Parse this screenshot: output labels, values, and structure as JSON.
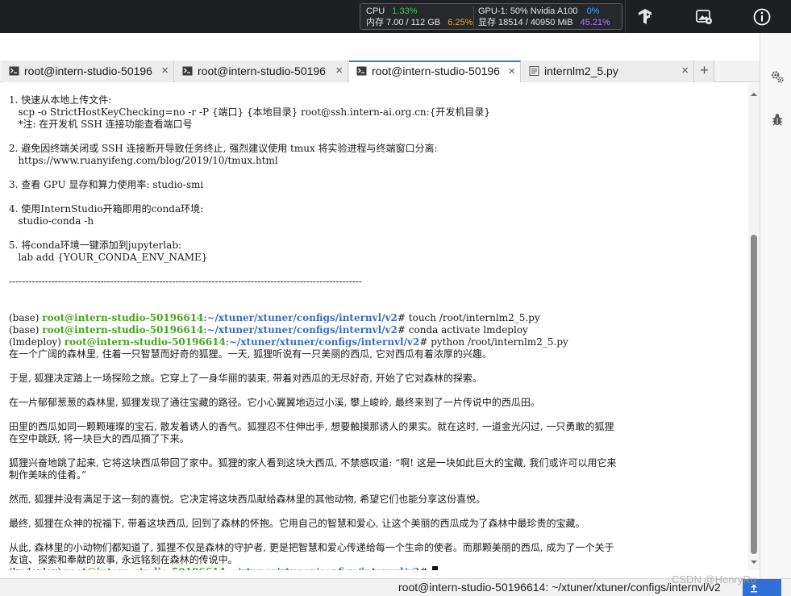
{
  "monitor": {
    "cpu_label": "CPU",
    "cpu_pct": "1.33%",
    "mem_text": "内存 7.00 / 112 GB",
    "mem_pct": "6.25%",
    "gpu_label": "GPU-1: 50% Nvidia A100",
    "gpu_pct": "0%",
    "vram_text": "显存 18514 / 40950 MiB",
    "vram_pct": "45.21%"
  },
  "topbar_icons": [
    "tensorflow-icon",
    "image-settings-icon",
    "info-icon"
  ],
  "tabs": [
    {
      "label": "root@intern-studio-50196",
      "icon": "terminal-icon",
      "active": false
    },
    {
      "label": "root@intern-studio-50196",
      "icon": "terminal-icon",
      "active": false
    },
    {
      "label": "root@intern-studio-50196",
      "icon": "terminal-icon",
      "active": true
    },
    {
      "label": "internlm2_5.py",
      "icon": "file-icon",
      "active": false
    }
  ],
  "tab_close_symbol": "×",
  "tab_add_symbol": "+",
  "terminal": {
    "lines": [
      "1. 快速从本地上传文件:",
      "   scp -o StrictHostKeyChecking=no -r -P {端口} {本地目录} root@ssh.intern-ai.org.cn:{开发机目录}",
      "   *注: 在开发机 SSH 连接功能查看端口号",
      "",
      "2. 避免因终端关闭或 SSH 连接断开导致任务终止, 强烈建议使用 tmux 将实验进程与终端窗口分离:",
      "   https://www.ruanyifeng.com/blog/2019/10/tmux.html",
      "",
      "3. 查看 GPU 显存和算力使用率: studio-smi",
      "",
      "4. 使用InternStudio开箱即用的conda环境:",
      "   studio-conda -h",
      "",
      "5. 将conda环境一键添加到jupyterlab:",
      "   lab add {YOUR_CONDA_ENV_NAME}",
      "",
      "------------------------------------------------------------------------------------------------------------"
    ],
    "prompts": [
      {
        "env": "(base) ",
        "user": "root@intern-studio-50196614",
        "path": "~/xtuner/xtuner/configs/internvl/v2",
        "cmd": "# touch /root/internlm2_5.py"
      },
      {
        "env": "(base) ",
        "user": "root@intern-studio-50196614",
        "path": "~/xtuner/xtuner/configs/internvl/v2",
        "cmd": "# conda activate lmdeploy"
      },
      {
        "env": "(lmdeploy) ",
        "user": "root@intern-studio-50196614",
        "path": "~/xtuner/xtuner/configs/internvl/v2",
        "cmd": "# python /root/internlm2_5.py"
      }
    ],
    "story": [
      "在一个广阔的森林里, 住着一只智慧而好奇的狐狸。一天, 狐狸听说有一只美丽的西瓜, 它对西瓜有着浓厚的兴趣。",
      "",
      "于是, 狐狸决定踏上一场探险之旅。它穿上了一身华丽的装束, 带着对西瓜的无尽好奇, 开始了它对森林的探索。",
      "",
      "在一片郁郁葱葱的森林里, 狐狸发现了通往宝藏的路径。它小心翼翼地迈过小溪, 攀上峻岭, 最终来到了一片传说中的西瓜田。",
      "",
      "田里的西瓜如同一颗颗璀璨的宝石, 散发着诱人的香气。狐狸忍不住伸出手, 想要触摸那诱人的果实。就在这时, 一道金光闪过, 一只勇敢的狐狸",
      "在空中跳跃, 将一块巨大的西瓜摘了下来。",
      "",
      "狐狸兴奋地跳了起来, 它将这块西瓜带回了家中。狐狸的家人看到这块大西瓜, 不禁感叹道: “啊! 这是一块如此巨大的宝藏, 我们或许可以用它来",
      "制作美味的佳肴。”",
      "",
      "然而, 狐狸并没有满足于这一刻的喜悦。它决定将这块西瓜献给森林里的其他动物, 希望它们也能分享这份喜悦。",
      "",
      "最终, 狐狸在众神的祝福下, 带着这块西瓜, 回到了森林的怀抱。它用自己的智慧和爱心, 让这个美丽的西瓜成为了森林中最珍贵的宝藏。",
      "",
      "从此, 森林里的小动物们都知道了, 狐狸不仅是森林的守护者, 更是把智慧和爱心传递给每一个生命的使者。而那颗美丽的西瓜, 成为了一个关于",
      "友谊、探索和奉献的故事, 永远铭刻在森林的传说中。"
    ],
    "final_prompt": {
      "env": "(lmdeploy) ",
      "user": "root@intern-studio-50196614",
      "path": "~/xtuner/xtuner/configs/internvl/v2",
      "cmd": "# "
    }
  },
  "right_icons": [
    "settings-gears-icon",
    "bug-icon"
  ],
  "status_path": "root@intern-studio-50196614: ~/xtuner/xtuner/configs/internvl/v2",
  "watermark": "CSDN @HenryRu"
}
